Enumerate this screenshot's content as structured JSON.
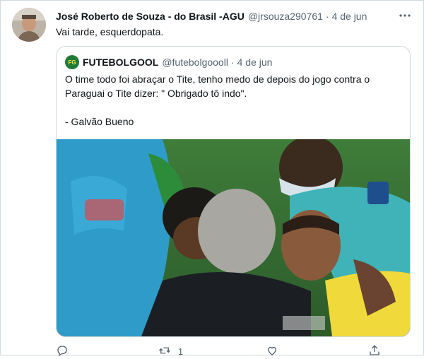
{
  "tweet": {
    "author_name": "José Roberto de Souza - do Brasil -AGU",
    "author_handle": "@jrsouza290761",
    "separator": "·",
    "time": "4 de jun",
    "text": "Vai tarde, esquerdopata.",
    "more_icon": "more-horizontal-icon"
  },
  "quote": {
    "avatar_text": "FG",
    "author_name": "FUTEBOLGOOL",
    "author_handle": "@futebolgoooll",
    "separator": "·",
    "time": "4 de jun",
    "text_line1": "O time todo foi abraçar o Tite, tenho medo de depois do jogo contra o Paraguai o Tite dizer:  \" Obrigado tô indo\".",
    "text_line2": "- Galvão Bueno",
    "media": "photo"
  },
  "actions": [
    {
      "icon": "reply-icon",
      "count": ""
    },
    {
      "icon": "retweet-icon",
      "count": "1"
    },
    {
      "icon": "like-icon",
      "count": ""
    },
    {
      "icon": "share-icon",
      "count": ""
    }
  ],
  "colors": {
    "text": "#0f1419",
    "secondary": "#536471",
    "border": "#cfd9de"
  }
}
